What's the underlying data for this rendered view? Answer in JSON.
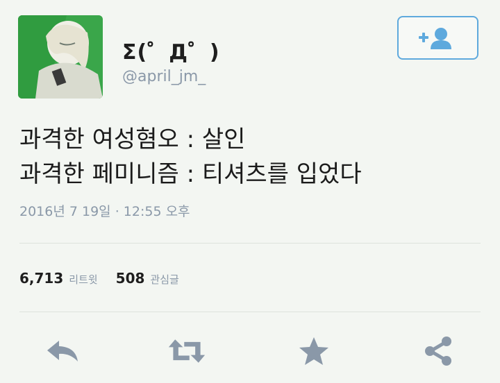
{
  "user": {
    "display_name": "Σ(゜Д゜)",
    "handle": "@april_jm_"
  },
  "follow_button": {
    "icon": "follow-user-icon"
  },
  "tweet": {
    "lines": [
      "과격한 여성혐오 : 살인",
      "과격한 페미니즘 : 티셔츠를 입었다"
    ],
    "timestamp": "2016년 7 19일 · 12:55 오후"
  },
  "stats": {
    "retweets": {
      "count": "6,713",
      "label": "리트윗"
    },
    "likes": {
      "count": "508",
      "label": "관심글"
    }
  },
  "actions": [
    {
      "name": "reply",
      "icon": "reply-icon"
    },
    {
      "name": "retweet",
      "icon": "retweet-icon"
    },
    {
      "name": "favorite",
      "icon": "star-icon"
    },
    {
      "name": "share",
      "icon": "share-icon"
    }
  ],
  "colors": {
    "accent": "#5ea9dd",
    "muted_text": "#8a98a8",
    "action_icon": "#8a98a8",
    "background": "#f3f6f2"
  }
}
